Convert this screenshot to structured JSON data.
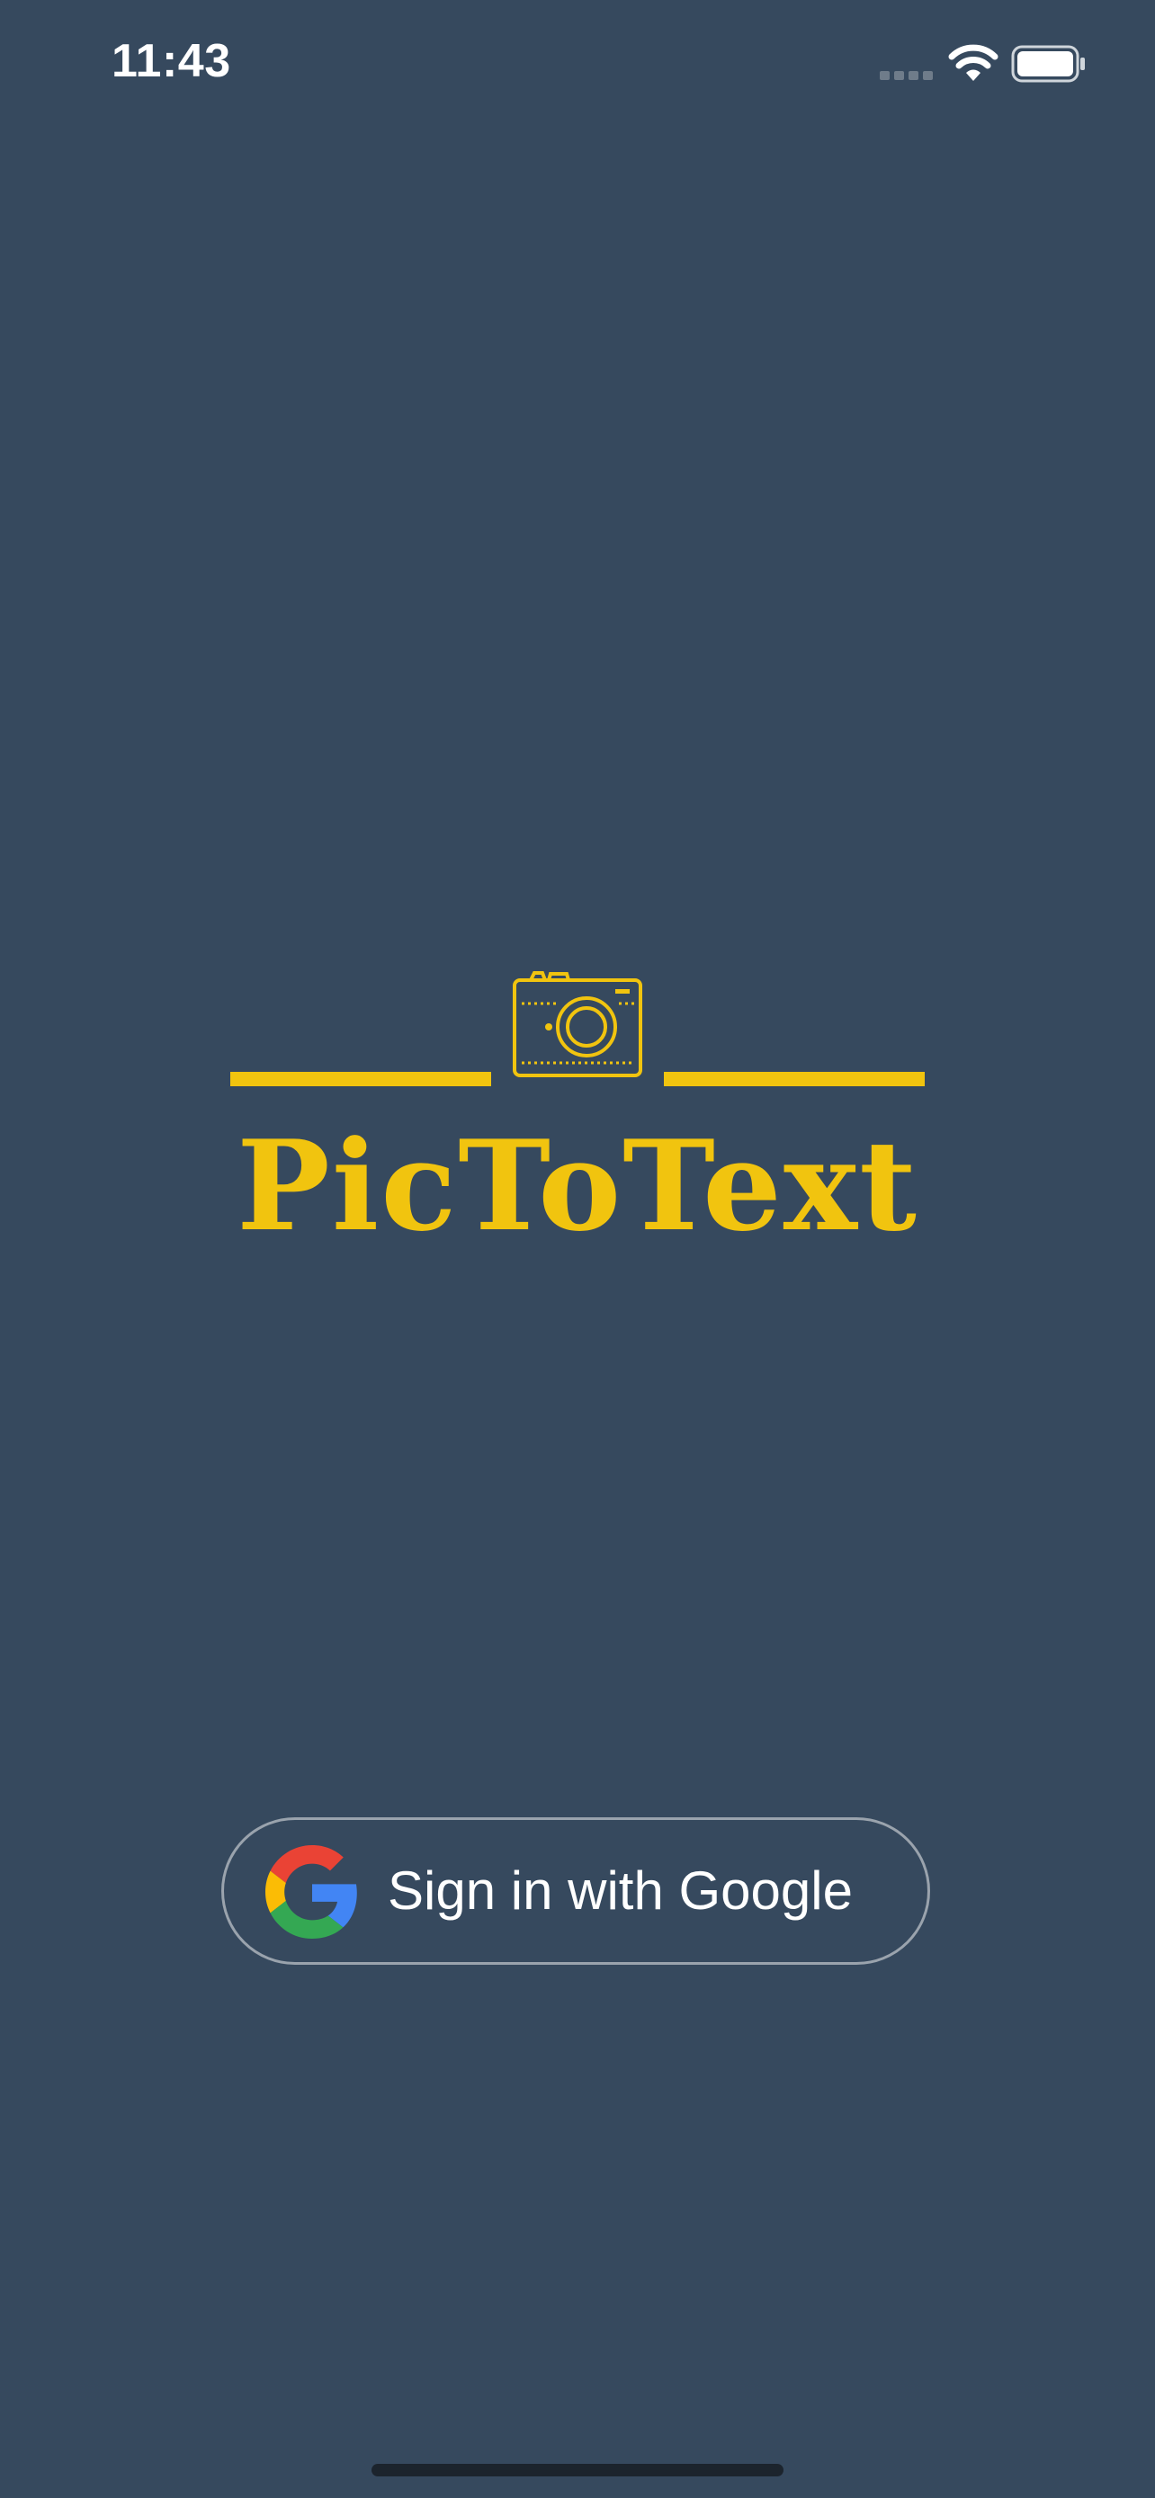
{
  "status_bar": {
    "time": "11:43"
  },
  "icons": {
    "signal": "cellular-signal-icon",
    "wifi": "wifi-icon",
    "battery": "battery-icon",
    "camera": "camera-icon",
    "google": "google-g-icon"
  },
  "app": {
    "title": "PicToText"
  },
  "auth": {
    "google_label": "Sign in with Google"
  },
  "colors": {
    "background": "#36495e",
    "accent": "#f1c40f",
    "button_border": "#9aa3ad",
    "text": "#ffffff"
  }
}
